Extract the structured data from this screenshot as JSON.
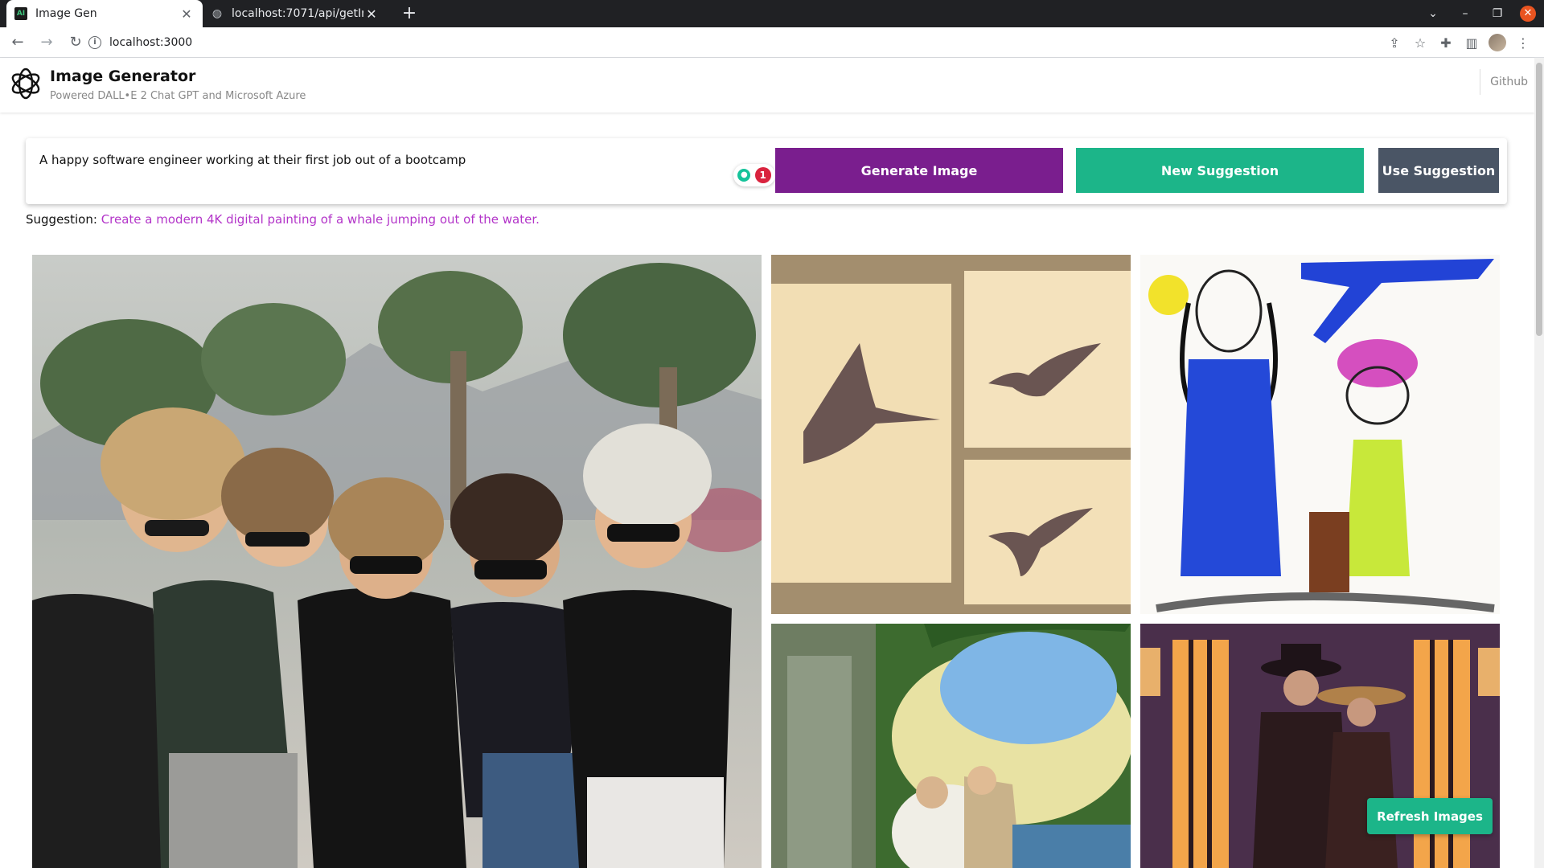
{
  "browser": {
    "tabs": [
      {
        "title": "Image Gen",
        "favicon": "ai-favicon-icon",
        "active": true
      },
      {
        "title": "localhost:7071/api/getIm",
        "favicon": "globe-icon",
        "active": false
      }
    ],
    "url": "localhost:3000",
    "favicon_text": "AI"
  },
  "header": {
    "title": "Image Generator",
    "subtitle": "Powered DALL•E 2 Chat GPT and Microsoft Azure",
    "github_label": "Github"
  },
  "prompt": {
    "value": "A happy software engineer working at their first job out of a bootcamp",
    "grammar_count": "1"
  },
  "buttons": {
    "generate": "Generate Image",
    "new_suggestion": "New Suggestion",
    "use_suggestion": "Use Suggestion",
    "refresh": "Refresh Images"
  },
  "suggestion": {
    "label": "Suggestion:",
    "text": "Create a modern 4K digital painting of a whale jumping out of the water."
  },
  "images": [
    {
      "subject": "photo-women-group"
    },
    {
      "subject": "hummingbirds-triptych"
    },
    {
      "subject": "crayon-drawing-travel"
    },
    {
      "subject": "painting-couple-garden"
    },
    {
      "subject": "noir-couple-street"
    }
  ],
  "colors": {
    "generate": "#7a1e8e",
    "new_suggestion": "#1cb589",
    "use_suggestion": "#4a5565",
    "suggestion_text": "#b335c9"
  }
}
